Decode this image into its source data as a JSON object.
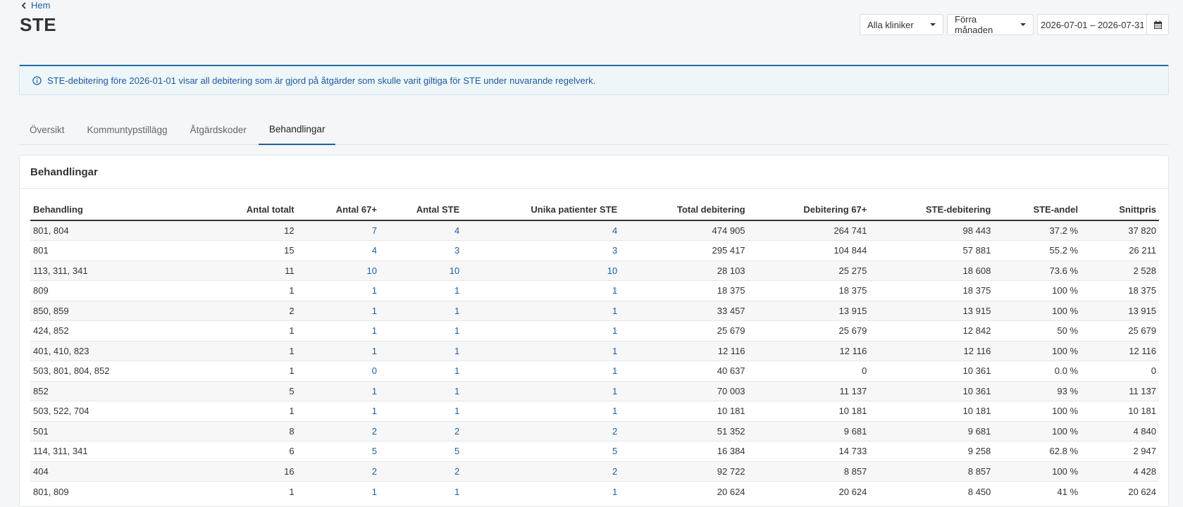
{
  "nav": {
    "back_label": "Hem",
    "title": "STE"
  },
  "filters": {
    "clinic": "Alla kliniker",
    "period": "Förra månaden",
    "date_range": "2026-07-01 – 2026-07-31"
  },
  "icons": {
    "back": "chevron-left-icon",
    "calendar": "calendar-icon",
    "info": "info-circle-icon"
  },
  "info_text": "STE-debitering före 2026-01-01 visar all debitering som är gjord på åtgärder som skulle varit giltiga för STE under nuvarande regelverk.",
  "tabs": [
    "Översikt",
    "Kommuntypstillägg",
    "Åtgärdskoder",
    "Behandlingar"
  ],
  "active_tab": 3,
  "card_title": "Behandlingar",
  "table": {
    "headers": [
      "Behandling",
      "Antal totalt",
      "Antal 67+",
      "Antal STE",
      "Unika patienter STE",
      "Total debitering",
      "Debitering 67+",
      "STE-debitering",
      "STE-andel",
      "Snittpris"
    ],
    "rows": [
      [
        "801, 804",
        "12",
        "7",
        "4",
        "4",
        "474 905",
        "264 741",
        "98 443",
        "37.2 %",
        "37 820"
      ],
      [
        "801",
        "15",
        "4",
        "3",
        "3",
        "295 417",
        "104 844",
        "57 881",
        "55.2 %",
        "26 211"
      ],
      [
        "113, 311, 341",
        "11",
        "10",
        "10",
        "10",
        "28 103",
        "25 275",
        "18 608",
        "73.6 %",
        "2 528"
      ],
      [
        "809",
        "1",
        "1",
        "1",
        "1",
        "18 375",
        "18 375",
        "18 375",
        "100 %",
        "18 375"
      ],
      [
        "850, 859",
        "2",
        "1",
        "1",
        "1",
        "33 457",
        "13 915",
        "13 915",
        "100 %",
        "13 915"
      ],
      [
        "424, 852",
        "1",
        "1",
        "1",
        "1",
        "25 679",
        "25 679",
        "12 842",
        "50 %",
        "25 679"
      ],
      [
        "401, 410, 823",
        "1",
        "1",
        "1",
        "1",
        "12 116",
        "12 116",
        "12 116",
        "100 %",
        "12 116"
      ],
      [
        "503, 801, 804, 852",
        "1",
        "0",
        "1",
        "1",
        "40 637",
        "0",
        "10 361",
        "0.0 %",
        "0"
      ],
      [
        "852",
        "5",
        "1",
        "1",
        "1",
        "70 003",
        "11 137",
        "10 361",
        "93 %",
        "11 137"
      ],
      [
        "503, 522, 704",
        "1",
        "1",
        "1",
        "1",
        "10 181",
        "10 181",
        "10 181",
        "100 %",
        "10 181"
      ],
      [
        "501",
        "8",
        "2",
        "2",
        "2",
        "51 352",
        "9 681",
        "9 681",
        "100 %",
        "4 840"
      ],
      [
        "114, 311, 341",
        "6",
        "5",
        "5",
        "5",
        "16 384",
        "14 733",
        "9 258",
        "62.8 %",
        "2 947"
      ],
      [
        "404",
        "16",
        "2",
        "2",
        "2",
        "92 722",
        "8 857",
        "8 857",
        "100 %",
        "4 428"
      ],
      [
        "801, 809",
        "1",
        "1",
        "1",
        "1",
        "20 624",
        "20 624",
        "8 450",
        "41 %",
        "20 624"
      ]
    ]
  }
}
